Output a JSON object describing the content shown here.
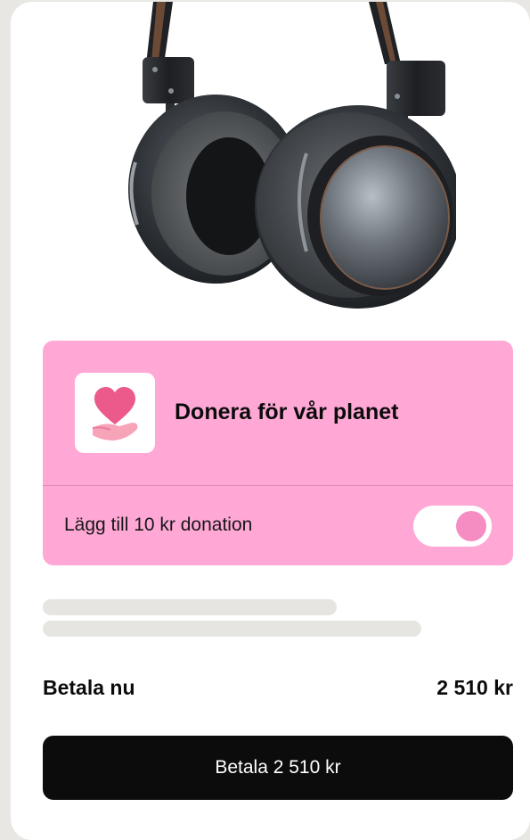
{
  "product": {
    "image_icon": "headphones-image"
  },
  "donation": {
    "icon": "heart-in-hand-icon",
    "title": "Donera för vår planet",
    "toggle_label": "Lägg till 10 kr donation",
    "toggle_on": true,
    "accent_color": "#ffa8d5"
  },
  "summary": {
    "label": "Betala nu",
    "amount": "2 510 kr"
  },
  "pay_button": {
    "label": "Betala 2 510 kr"
  }
}
